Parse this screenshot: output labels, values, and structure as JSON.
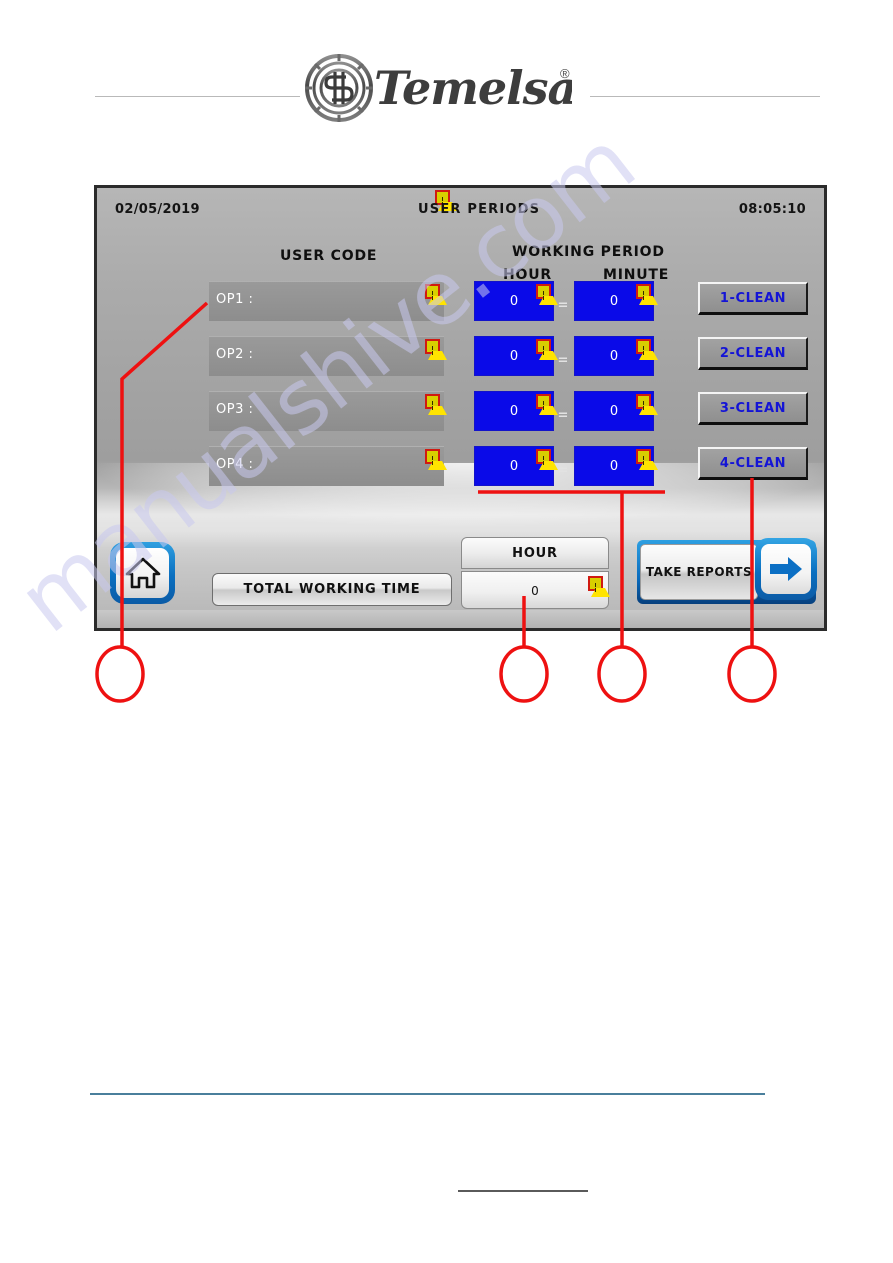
{
  "branding": {
    "logo_word": "Temelsan",
    "registered_mark": "®",
    "logo_mark_icon": "temelsan-gear-emblem"
  },
  "watermark": {
    "text": "manualshive.com"
  },
  "hmi": {
    "status_bar": {
      "date": "02/05/2019",
      "title": "USER PERIODS",
      "time": "08:05:10",
      "warning_icon": "warning-triangle-icon"
    },
    "headings": {
      "user_code": "USER CODE",
      "working_period": "WORKING PERIOD",
      "hour": "HOUR",
      "minute": "MINUTE"
    },
    "separator": "=",
    "rows": [
      {
        "label": "OP1  :",
        "user_code_value": "",
        "hour": "0",
        "minute": "0",
        "clean_button": "1-CLEAN"
      },
      {
        "label": "OP2  :",
        "user_code_value": "",
        "hour": "0",
        "minute": "0",
        "clean_button": "2-CLEAN"
      },
      {
        "label": "OP3  :",
        "user_code_value": "",
        "hour": "0",
        "minute": "0",
        "clean_button": "3-CLEAN"
      },
      {
        "label": "OP4  :",
        "user_code_value": "",
        "hour": "0",
        "minute": "0",
        "clean_button": "4-CLEAN"
      }
    ],
    "footer": {
      "home_icon": "home-icon",
      "total_working_time": "TOTAL WORKING TIME",
      "hour_panel_label": "HOUR",
      "hour_panel_value": "0",
      "take_reports": "TAKE REPORTS",
      "next_icon": "arrow-right-icon"
    }
  },
  "annotations": {
    "marker_color": "#ee1111",
    "callouts": [
      {
        "label": "",
        "target": "user-code-field"
      },
      {
        "label": "",
        "target": "total-hour-value"
      },
      {
        "label": "",
        "target": "working-period-columns"
      },
      {
        "label": "",
        "target": "clean-buttons"
      }
    ]
  },
  "colors": {
    "screen_bg": "#a8a8a8",
    "numeric_field": "#0a0ae8",
    "clean_text": "#1414d6",
    "accent_blue": "#0a6fc0",
    "warning_yellow": "#ffe400",
    "warning_border": "#d01a11",
    "footer_rule": "#4a7f9c"
  }
}
